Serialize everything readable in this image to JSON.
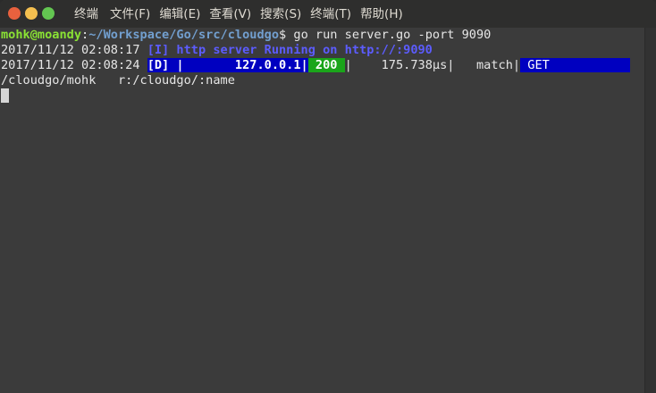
{
  "window": {
    "buttons": [
      "close",
      "minimize",
      "maximize"
    ]
  },
  "menu": {
    "items": [
      "终端",
      "文件(F)",
      "编辑(E)",
      "查看(V)",
      "搜索(S)",
      "终端(T)",
      "帮助(H)"
    ]
  },
  "terminal": {
    "line1": {
      "user": "mohk@moandy",
      "sep": ":",
      "path": "~/Workspace/Go/src/cloudgo",
      "command": "$ go run server.go -port 9090"
    },
    "line2": {
      "timestamp": "2017/11/12 02:08:17 ",
      "message": "[I] http server Running on http://:9090"
    },
    "line3": {
      "timestamp": "2017/11/12 02:08:24 ",
      "level": "[D] |       127.0.0.1|",
      "status": " 200 ",
      "timing": "|    175.738µs|   match|",
      "method": " GET           "
    },
    "line4": {
      "text": "/cloudgo/mohk   r:/cloudgo/:name"
    }
  },
  "colors": {
    "background": "#3b3b3b",
    "prompt_user": "#8ae234",
    "prompt_path": "#729fcf",
    "info": "#5c5cff",
    "debug_bg": "#0000c0",
    "status_ok_bg": "#1aa51a"
  }
}
